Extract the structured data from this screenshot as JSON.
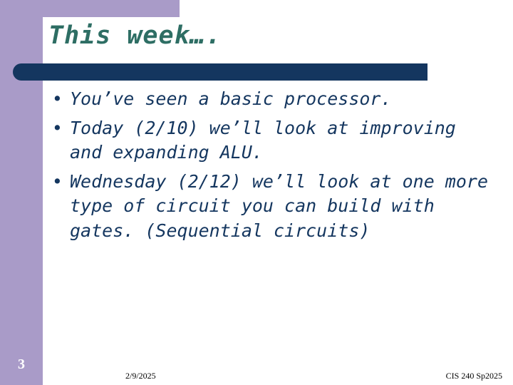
{
  "slide": {
    "title": "This week….",
    "bullets": [
      "You’ve seen a basic processor.",
      "Today (2/10) we’ll look at improving and expanding ALU.",
      "Wednesday (2/12) we’ll look at one more type of circuit you can build with gates. (Sequential circuits)"
    ],
    "bullet_glyph": "•",
    "number": "3"
  },
  "footer": {
    "date": "2/9/2025",
    "course": "CIS 240 Sp2025"
  },
  "colors": {
    "sidebar": "#a99bc8",
    "title_text": "#2e6e64",
    "title_bar": "#14365f",
    "body_text": "#14365f"
  }
}
